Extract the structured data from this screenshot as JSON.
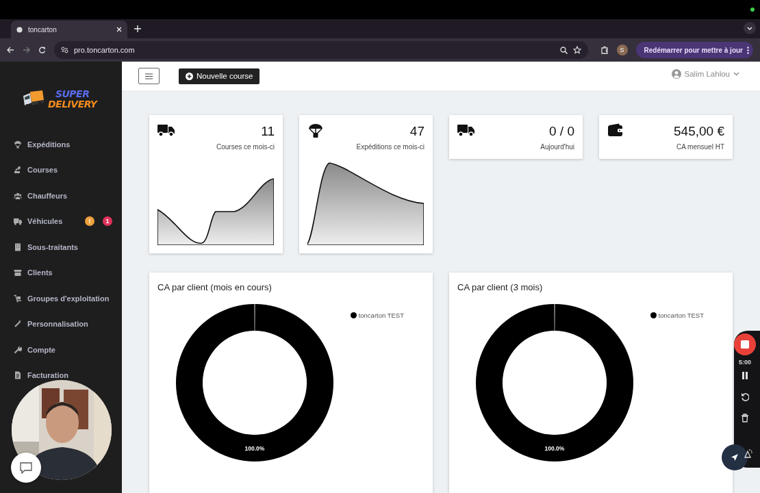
{
  "browser": {
    "tab_title": "toncarton",
    "url": "pro.toncarton.com",
    "profile_initial": "S",
    "update_button": "Redémarrer pour mettre à jour"
  },
  "sidebar": {
    "logo": {
      "line_1": "SUPER",
      "line_2": "DELIVERY"
    },
    "items": [
      {
        "label": "Expéditions"
      },
      {
        "label": "Courses"
      },
      {
        "label": "Chauffeurs"
      },
      {
        "label": "Véhicules",
        "badges": [
          {
            "text": "!",
            "color": "#f0a03c"
          },
          {
            "text": "1",
            "color": "#e0325a"
          }
        ]
      },
      {
        "label": "Sous-traitants"
      },
      {
        "label": "Clients"
      },
      {
        "label": "Groupes d'exploitation"
      },
      {
        "label": "Personnalisation"
      },
      {
        "label": "Compte"
      },
      {
        "label": "Facturation"
      }
    ]
  },
  "topbar": {
    "new_button": "Nouvelle course",
    "user": "Salim Lahlou"
  },
  "stats": [
    {
      "value": "11",
      "label": "Courses ce mois-ci",
      "kind": "sparkline"
    },
    {
      "value": "47",
      "label": "Expéditions ce mois-ci",
      "kind": "sparkline"
    },
    {
      "value": "0 / 0",
      "label": "Aujourd'hui",
      "kind": "plain"
    },
    {
      "value": "545,00 €",
      "label": "CA mensuel HT",
      "kind": "plain"
    }
  ],
  "charts": [
    {
      "title": "CA par client (mois en cours)",
      "chart_data": {
        "type": "donut",
        "categories": [
          "toncarton TEST"
        ],
        "values": [
          100
        ],
        "value_labels": [
          "100.0%"
        ]
      }
    },
    {
      "title": "CA par client (3 mois)",
      "chart_data": {
        "type": "donut",
        "categories": [
          "toncarton TEST"
        ],
        "values": [
          100
        ],
        "value_labels": [
          "100.0%"
        ]
      }
    }
  ],
  "recorder": {
    "timer": "5:00"
  }
}
